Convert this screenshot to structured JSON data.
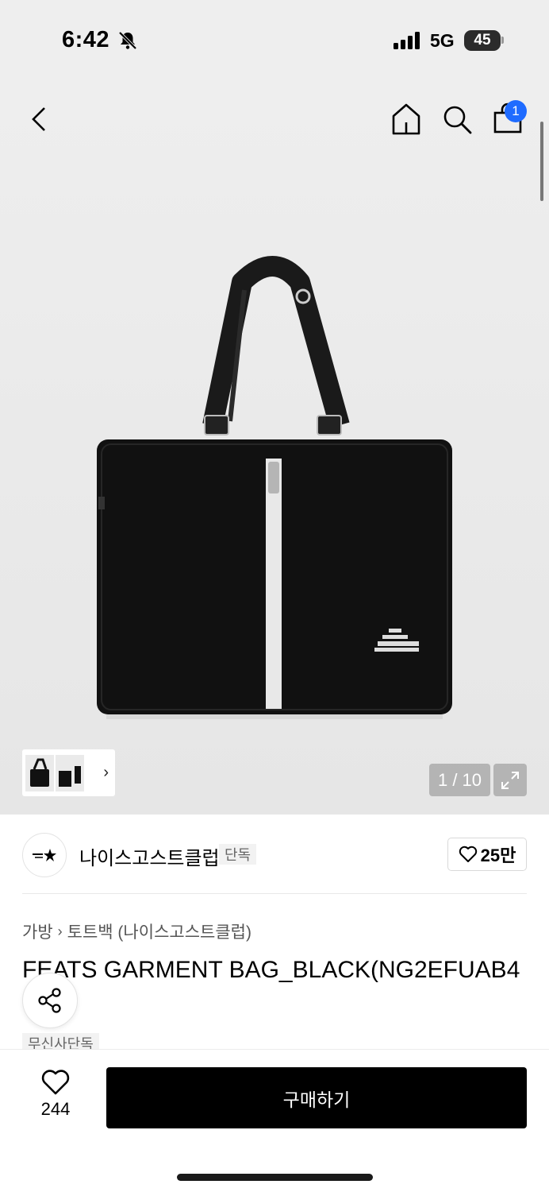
{
  "status_bar": {
    "time": "6:42",
    "network": "5G",
    "battery": "45"
  },
  "nav": {
    "cart_badge": "1"
  },
  "gallery": {
    "counter": "1 / 10"
  },
  "brand": {
    "name": "나이스고스트클럽",
    "tag": "단독",
    "like_count": "25만"
  },
  "breadcrumb": {
    "category": "가방",
    "subcategory": "토트백 (나이스고스트클럽)"
  },
  "product": {
    "title": "FEATS GARMENT BAG_BLACK(NG2EFUAB4",
    "exclusive_tag": "무신사단독"
  },
  "bottom_bar": {
    "wish_count": "244",
    "buy_label": "구매하기"
  },
  "colors": {
    "accent_badge": "#1f6bff",
    "buy_button": "#000000"
  }
}
